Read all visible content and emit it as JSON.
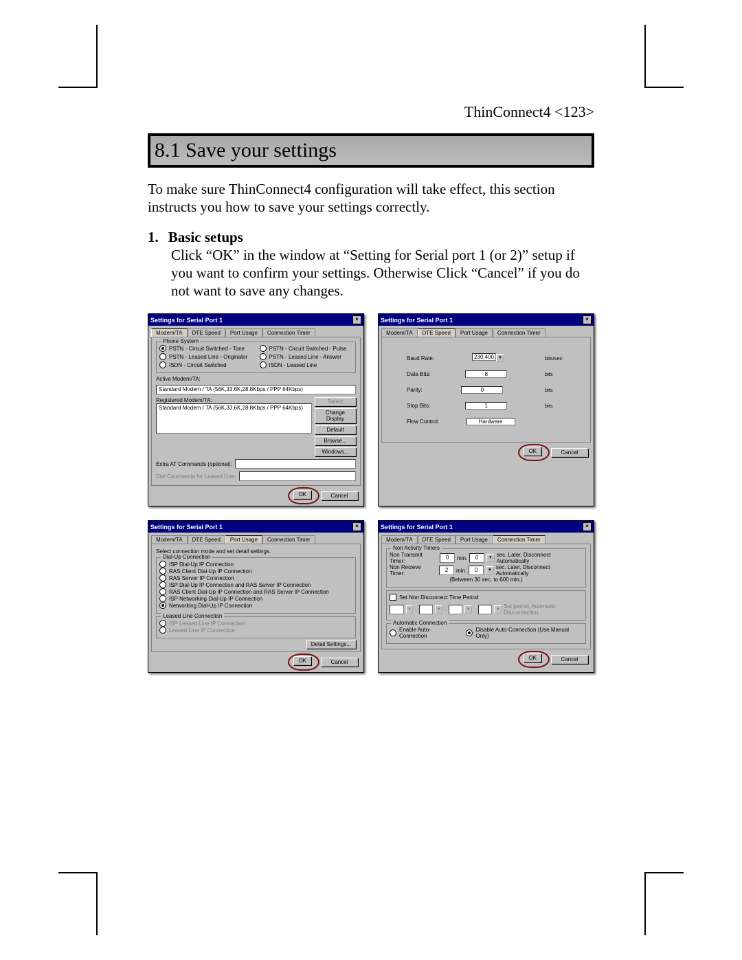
{
  "header": {
    "product": "ThinConnect4",
    "page": "<123>"
  },
  "section": {
    "title": "8.1 Save your settings"
  },
  "intro": "To make sure ThinConnect4 configuration will take effect, this section instructs you how to save your settings correctly.",
  "item1": {
    "num": "1.",
    "head": "Basic setups",
    "body": "Click “OK” in the window at “Setting for Serial port 1 (or 2)” setup if you want to confirm your settings.  Otherwise Click “Cancel” if you do not want to save any changes."
  },
  "dialog_common": {
    "title": "Settings for Serial Port 1",
    "close": "×",
    "ok": "OK",
    "cancel": "Cancel",
    "tabs": [
      "Modem/TA",
      "DTE Speed",
      "Port Usage",
      "Connection Timer"
    ]
  },
  "dlg1": {
    "group_phone": "Phone System",
    "radios_left": [
      "PSTN - Circuit Switched - Tone",
      "PSTN - Leased Line - Originator",
      "ISDN - Circuit Switched"
    ],
    "radios_right": [
      "PSTN - Circuit Switched - Pulse",
      "PSTN - Leased Line - Answer",
      "ISDN - Leased Line"
    ],
    "active_label": "Active Modem/TA:",
    "active_value": "Standard Modem / TA (56K,33.6K,28.8Kbps / PPP 64Kbps)",
    "reg_label": "Registered Modem/TA:",
    "reg_value": "Standard Modem / TA (56K,33.6K,28.8Kbps / PPP 64Kbps)",
    "btn_select": "Select",
    "btn_change": "Change Display",
    "btn_default": "Default",
    "btn_browse": "Browse...",
    "btn_windows": "Windows...",
    "extra_label": "Extra AT Commands (optional):",
    "dial_label": "Dial Commands for Leased Line:"
  },
  "dlg2": {
    "rows": [
      {
        "label": "Baud Rate:",
        "value": "230,400",
        "unit": "bits/sec",
        "dd": true
      },
      {
        "label": "Data Bits:",
        "value": "8",
        "unit": "bits"
      },
      {
        "label": "Parity:",
        "value": "0",
        "unit": "bits"
      },
      {
        "label": "Stop Bits:",
        "value": "1",
        "unit": "bits"
      },
      {
        "label": "Flow Control:",
        "value": "Hardware",
        "unit": ""
      }
    ]
  },
  "dlg3": {
    "intro": "Select connection mode and set detail settings.",
    "group_dial": "Dial-Up Connection",
    "dial_opts": [
      "ISP Dial-Up IP Connection",
      "RAS Client Dial-Up IP Connection",
      "RAS Server IP Connection",
      "ISP Dial-Up IP Connection and RAS Server IP Connection",
      "RAS Client Dial-Up IP Connection and RAS Server IP Connection",
      "ISP Networking Dial-Up IP Connection",
      "Networking Dial-Up IP Connection"
    ],
    "group_leased": "Leased Line Connection",
    "leased_opts": [
      "ISP Leased Line IP Connection",
      "Leased Line IP Connection"
    ],
    "btn_detail": "Detail Settings..."
  },
  "dlg4": {
    "group_nat": "Non Activity Timers",
    "nt_row": {
      "label": "Non Transmit Timer:",
      "v1": "0",
      "u1": "min.",
      "v2": "0",
      "tail": "sec. Later, Disconnect Automatically"
    },
    "nr_row": {
      "label": "Non Recieve Timer:",
      "v1": "2",
      "u1": "min.",
      "v2": "0",
      "tail": "sec. Later, Disconnect Automatically"
    },
    "range": "(Between 30 sec. to 600 min.)",
    "chk_period": "Set Non Disconnect Time Period",
    "period_tail": "Set period, Automatic Disconnection",
    "group_auto": "Automatic Connection",
    "auto_on": "Enable Auto-Connection",
    "auto_off": "Disable Auto-Connection (Use Manual Only)"
  }
}
